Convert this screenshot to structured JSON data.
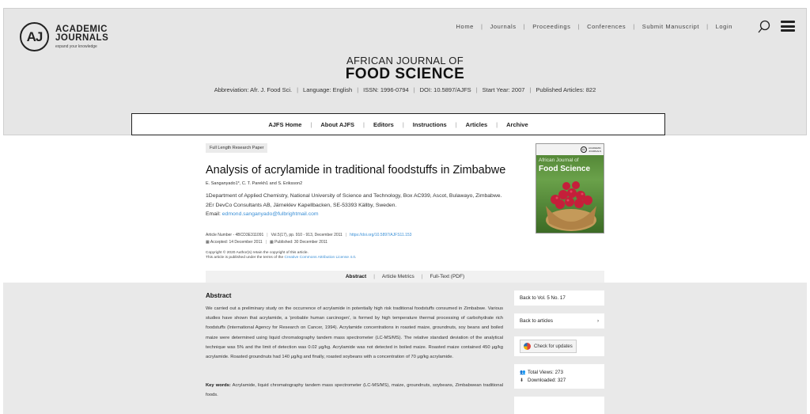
{
  "logo": {
    "mark": "AJ",
    "line1": "ACADEMIC",
    "line2": "JOURNALS",
    "tagline": "expand your knowledge"
  },
  "topnav": {
    "items": [
      "Home",
      "Journals",
      "Proceedings",
      "Conferences",
      "Submit Manuscript",
      "Login"
    ]
  },
  "journal": {
    "title_small": "AFRICAN JOURNAL OF",
    "title_big": "FOOD SCIENCE",
    "meta": [
      "Abbreviation: Afr. J. Food Sci.",
      "Language: English",
      "ISSN: 1996-0794",
      "DOI: 10.5897/AJFS",
      "Start Year: 2007",
      "Published Articles: 822"
    ]
  },
  "subnav": {
    "items": [
      "AJFS Home",
      "About AJFS",
      "Editors",
      "Instructions",
      "Articles",
      "Archive"
    ]
  },
  "article": {
    "type": "Full Length Research Paper",
    "title": "Analysis of acrylamide in traditional foodstuffs in Zimbabwe",
    "authors": "E. Sanganyado1*, C. T. Parekh1 and S. Eriksson2",
    "affiliation": "1Department of Applied Chemistry, National University of Science and Technology, Box AC939, Ascot, Bulawayo, Zimbabwe. 2Er DevCo Consultants AB, Järneklev Kapellbacken, SE-53393 Källby, Sweden.",
    "email_label": "Email: ",
    "email": "edmond.sanganyado@fulbrightmail.com",
    "article_number": "Article Number - 4BCD3E311091",
    "volume": "Vol.5(17), pp. 910 - 913, December 2011",
    "doi_link": "https://doi.org/10.5897/AJFS11.153",
    "accepted": "Accepted: 14 December 2011",
    "published": "Published: 30 December 2011",
    "copyright1": "Copyright © 2020 Author(s) retain the copyright of this article.",
    "copyright2": "This article is published under the terms of the ",
    "license": "Creative Commons Attribution License 4.0",
    "copyright_end": "."
  },
  "cover": {
    "t1": "African Journal of",
    "t2": "Food Science",
    "logo1": "ACADEMIC",
    "logo2": "JOURNALS"
  },
  "tabs": {
    "active": "Abstract",
    "metrics": "Article Metrics",
    "fulltext": "Full-Text (PDF)"
  },
  "abstract": {
    "heading": "Abstract",
    "text": "We carried out a preliminary study on the occurrence of acrylamide in potentially high risk traditional foodstuffs consumed in Zimbabwe. Various studies have shown that acrylamide, a 'probable human carcinogen', is formed by high temperature thermal processing of carbohydrate rich foodstuffs (International Agency for Research on Cancer, 1994). Acrylamide concentrations in roasted maize, groundnuts, soy beans and boiled maize were determined using liquid chromatography tandem mass spectrometer (LC-MS/MS). The relative standard deviation of the analytical technique was 5% and the limit of detection was 0.02 μg/kg. Acrylamide was not detected in boiled maize. Roasted maize contained 450 μg/kg acrylamide. Roasted groundnuts had 140 μg/kg and finally, roasted soybeans with a concentration of 70 μg/kg acrylamide.",
    "keywords_label": "Key words:",
    "keywords": " Acrylamide, liquid chromatography tandem mass spectrometer (LC-MS/MS), maize, groundnuts, soybeans, Zimbabwean traditional foods."
  },
  "sidebar": {
    "back_vol": "Back to Vol. 5 No. 17",
    "back_articles": "Back to articles",
    "check_updates": "Check for updates",
    "total_views": "Total Views: 273",
    "downloaded": "Downloaded: 327"
  },
  "colors": {
    "link": "#3a8fd6",
    "header_bg": "#e6e6e6",
    "band_bg": "#e9e9e9"
  }
}
